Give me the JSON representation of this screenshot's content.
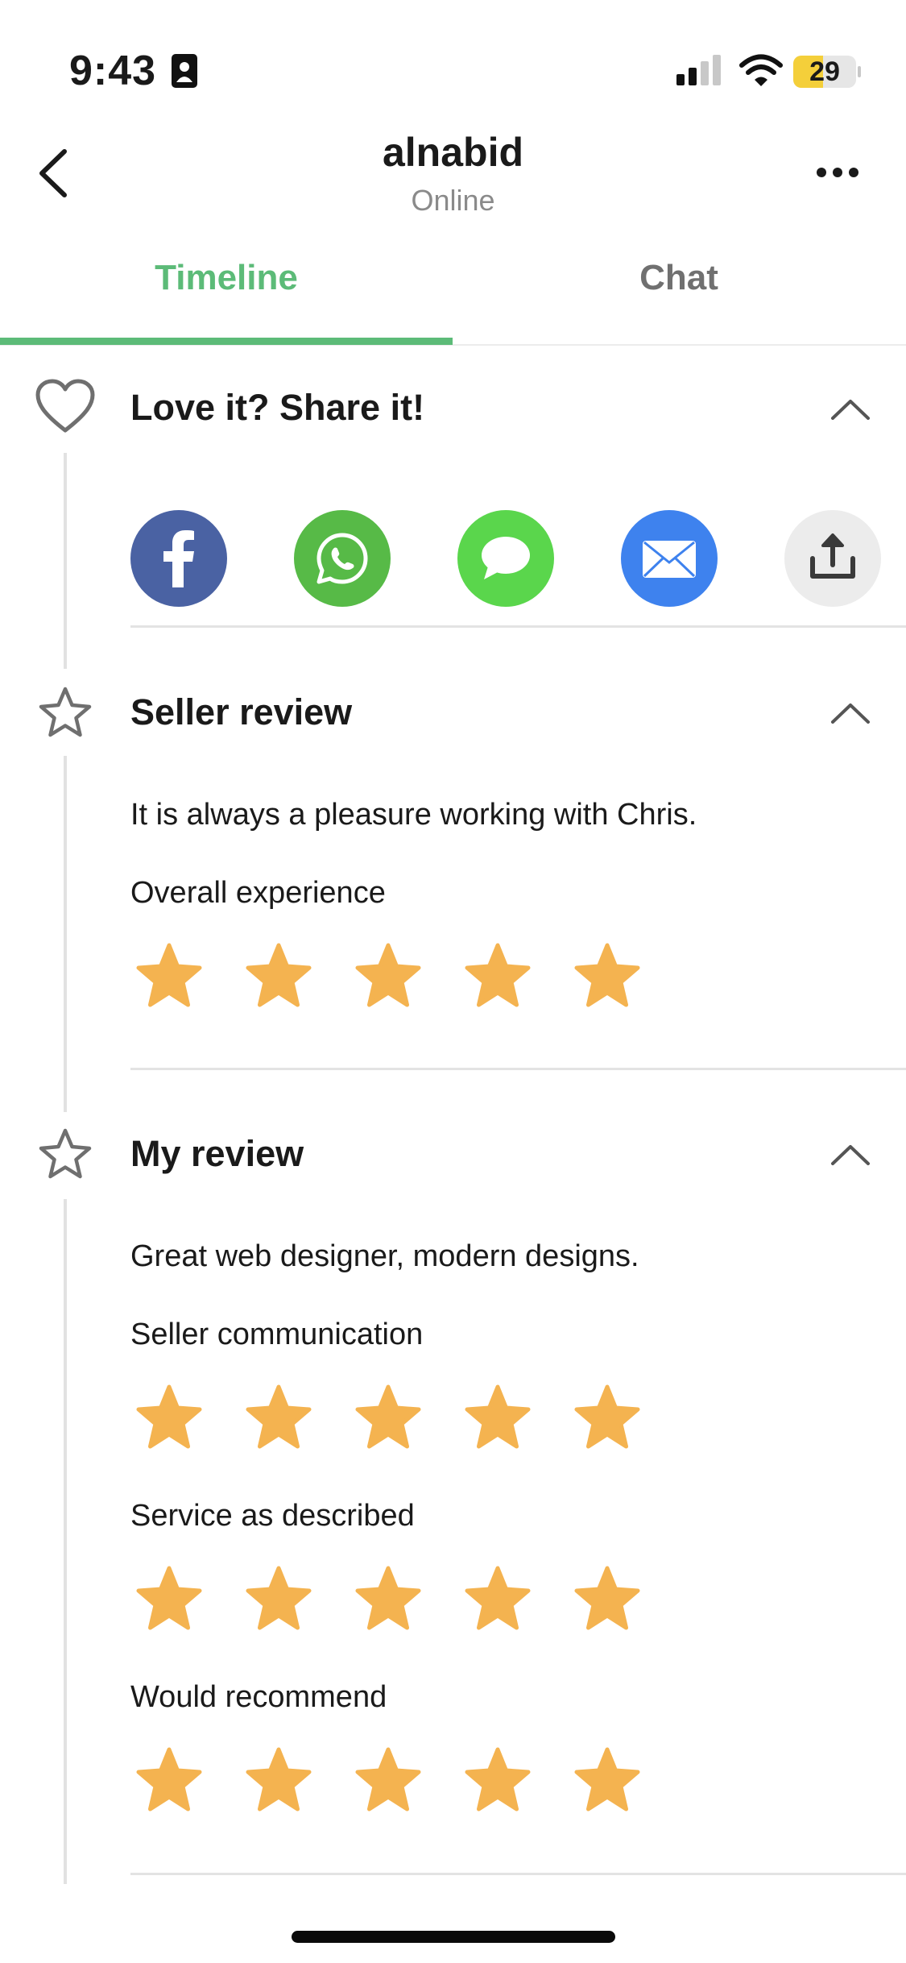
{
  "status_bar": {
    "time": "9:43",
    "battery": "29"
  },
  "header": {
    "title": "alnabid",
    "subtitle": "Online"
  },
  "tabs": [
    {
      "label": "Timeline",
      "active": true
    },
    {
      "label": "Chat",
      "active": false
    }
  ],
  "share_section": {
    "title": "Love it? Share it!",
    "buttons": [
      {
        "name": "facebook",
        "icon": "facebook-icon",
        "color": "#4a62a3"
      },
      {
        "name": "whatsapp",
        "icon": "whatsapp-icon",
        "color": "#57ba47"
      },
      {
        "name": "messages",
        "icon": "message-bubble-icon",
        "color": "#5ad64c"
      },
      {
        "name": "email",
        "icon": "envelope-icon",
        "color": "#3e82ee"
      },
      {
        "name": "more-share",
        "icon": "share-upload-icon",
        "color": "#ececec"
      }
    ]
  },
  "seller_review": {
    "title": "Seller review",
    "comment": "It is always a pleasure working with Chris.",
    "ratings": [
      {
        "label": "Overall experience",
        "stars": 5,
        "max": 5
      }
    ]
  },
  "my_review": {
    "title": "My review",
    "comment": "Great web designer, modern designs.",
    "ratings": [
      {
        "label": "Seller communication",
        "stars": 5,
        "max": 5
      },
      {
        "label": "Service as described",
        "stars": 5,
        "max": 5
      },
      {
        "label": "Would recommend",
        "stars": 5,
        "max": 5
      }
    ]
  },
  "colors": {
    "accent": "#5cbb78",
    "star": "#f4b350"
  }
}
